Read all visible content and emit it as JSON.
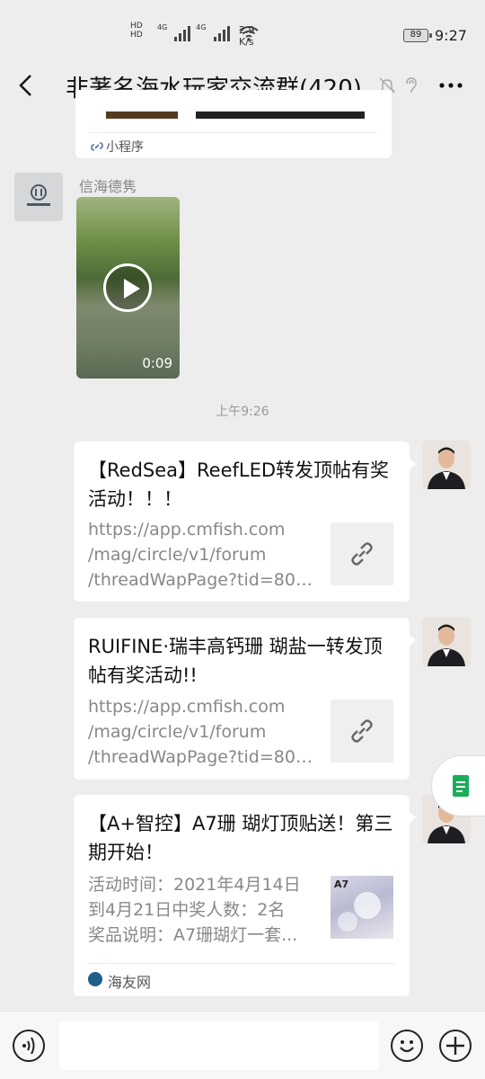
{
  "status_bar": {
    "hd1": "HD",
    "hd2": "HD",
    "net1": "4G",
    "net2": "4G",
    "speed_value": "2.9",
    "speed_unit": "K/s",
    "battery": "89",
    "time": "9:27"
  },
  "header": {
    "title": "非著名海水玩家交流群(420)",
    "icons": [
      "back-icon",
      "mute-bell-icon",
      "ear-icon",
      "more-icon"
    ]
  },
  "messages": {
    "mini_program": {
      "label": "小程序"
    },
    "video_msg": {
      "sender": "信海德隽",
      "duration": "0:09"
    },
    "timestamp": "上午9:26",
    "link1": {
      "title": "【RedSea】ReefLED转发顶帖有奖活动！！！",
      "desc": [
        "https://app.cmfish.com",
        "/mag/circle/v1/forum",
        "/threadWapPage?tid=800..."
      ]
    },
    "link2": {
      "title": "RUIFINE·瑞丰高钙珊 瑚盐一转发顶帖有奖活动!!",
      "desc": [
        "https://app.cmfish.com",
        "/mag/circle/v1/forum",
        "/threadWapPage?tid=803..."
      ]
    },
    "link3": {
      "title": "【A+智控】A7珊 瑚灯顶贴送！第三期开始！",
      "desc": [
        "活动时间：2021年4月14日",
        "到4月21日中奖人数：2名",
        "奖品说明：A7珊瑚灯一套..."
      ],
      "source": "海友网",
      "thumb_text": "A7"
    }
  },
  "input": {
    "placeholder": ""
  }
}
